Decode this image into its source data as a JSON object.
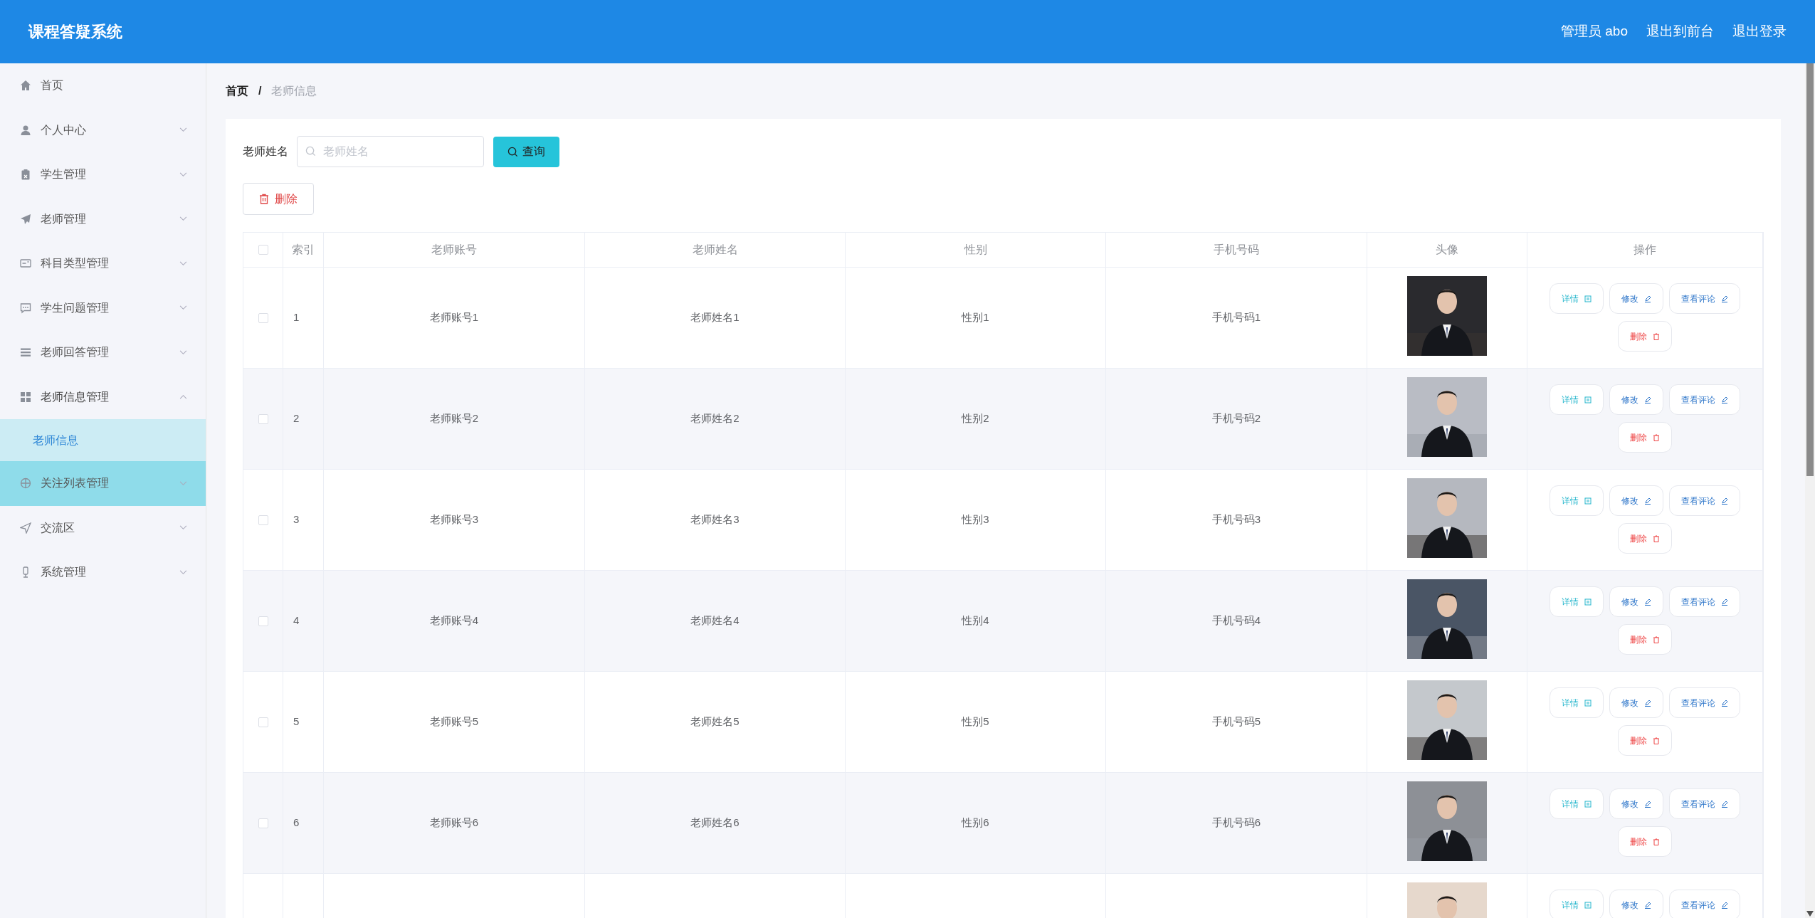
{
  "header": {
    "title": "课程答疑系统",
    "links": [
      "管理员 abo",
      "退出到前台",
      "退出登录"
    ]
  },
  "sidebar": {
    "items": [
      {
        "label": "首页",
        "has_arrow": false,
        "expanded": false,
        "hovered": false
      },
      {
        "label": "个人中心",
        "has_arrow": true,
        "expanded": false,
        "hovered": false
      },
      {
        "label": "学生管理",
        "has_arrow": true,
        "expanded": false,
        "hovered": false
      },
      {
        "label": "老师管理",
        "has_arrow": true,
        "expanded": false,
        "hovered": false
      },
      {
        "label": "科目类型管理",
        "has_arrow": true,
        "expanded": false,
        "hovered": false
      },
      {
        "label": "学生问题管理",
        "has_arrow": true,
        "expanded": false,
        "hovered": false
      },
      {
        "label": "老师回答管理",
        "has_arrow": true,
        "expanded": false,
        "hovered": false
      },
      {
        "label": "老师信息管理",
        "has_arrow": true,
        "expanded": true,
        "hovered": false,
        "children": [
          {
            "label": "老师信息",
            "selected": true
          }
        ]
      },
      {
        "label": "关注列表管理",
        "has_arrow": true,
        "expanded": false,
        "hovered": true
      },
      {
        "label": "交流区",
        "has_arrow": true,
        "expanded": false,
        "hovered": false
      },
      {
        "label": "系统管理",
        "has_arrow": true,
        "expanded": false,
        "hovered": false
      }
    ]
  },
  "breadcrumb": {
    "home": "首页",
    "separator": "/",
    "current": "老师信息"
  },
  "search": {
    "label": "老师姓名",
    "placeholder": "老师姓名",
    "button": "查询"
  },
  "delete_button": "删除",
  "table": {
    "all_checked": false,
    "columns": [
      "索引",
      "老师账号",
      "老师姓名",
      "性别",
      "手机号码",
      "头像",
      "操作"
    ],
    "rows": [
      {
        "index": "1",
        "account": "老师账号1",
        "name": "老师姓名1",
        "gender": "性别1",
        "phone": "手机号码1",
        "checked": false,
        "actions": [
          "详情",
          "修改",
          "查看评论",
          "删除"
        ]
      },
      {
        "index": "2",
        "account": "老师账号2",
        "name": "老师姓名2",
        "gender": "性别2",
        "phone": "手机号码2",
        "checked": false,
        "actions": [
          "详情",
          "修改",
          "查看评论",
          "删除"
        ]
      },
      {
        "index": "3",
        "account": "老师账号3",
        "name": "老师姓名3",
        "gender": "性别3",
        "phone": "手机号码3",
        "checked": false,
        "actions": [
          "详情",
          "修改",
          "查看评论",
          "删除"
        ]
      },
      {
        "index": "4",
        "account": "老师账号4",
        "name": "老师姓名4",
        "gender": "性别4",
        "phone": "手机号码4",
        "checked": false,
        "actions": [
          "详情",
          "修改",
          "查看评论",
          "删除"
        ]
      },
      {
        "index": "5",
        "account": "老师账号5",
        "name": "老师姓名5",
        "gender": "性别5",
        "phone": "手机号码5",
        "checked": false,
        "actions": [
          "详情",
          "修改",
          "查看评论",
          "删除"
        ]
      },
      {
        "index": "6",
        "account": "老师账号6",
        "name": "老师姓名6",
        "gender": "性别6",
        "phone": "手机号码6",
        "checked": false,
        "actions": [
          "详情",
          "修改",
          "查看评论",
          "删除"
        ]
      },
      {
        "actions": [
          "详情",
          "修改",
          "查看评论"
        ]
      }
    ]
  }
}
